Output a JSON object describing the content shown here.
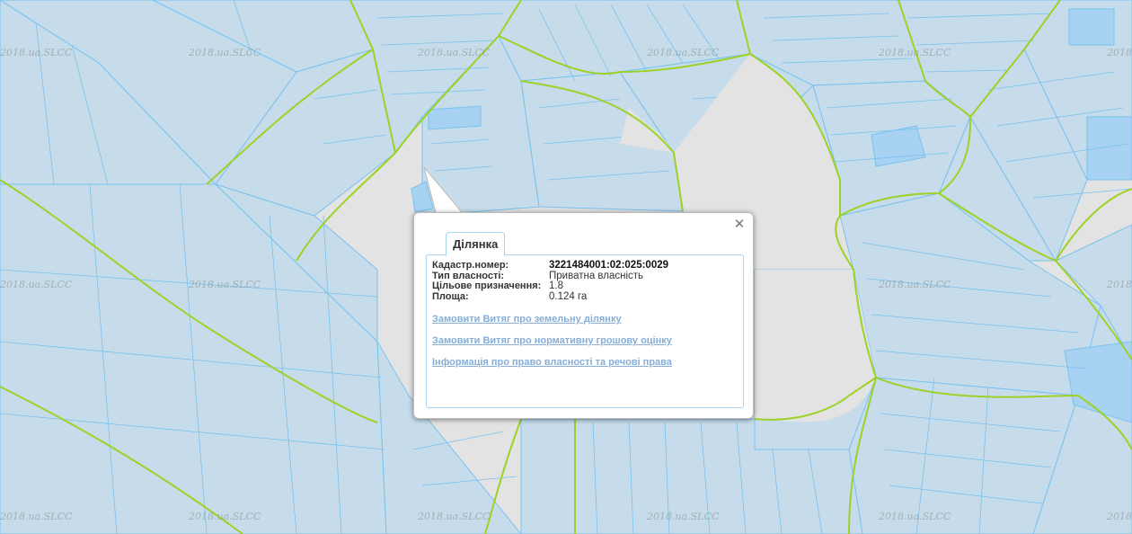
{
  "map": {
    "watermark": "2018.ua.SLCC",
    "colors": {
      "background": "#e3e3e3",
      "parcel_fill": "#c6dcea",
      "parcel_fill_selected": "#a8d2f2",
      "parcel_stroke": "#79c2ee",
      "boundary": "#9ed127"
    }
  },
  "popup": {
    "tab_label": "Ділянка",
    "close_icon": "close-icon",
    "fields": [
      {
        "label": "Кадастр.номер:",
        "value": "3221484001:02:025:0029"
      },
      {
        "label": "Тип власності:",
        "value": "Приватна власність"
      },
      {
        "label": "Цільове призначення:",
        "value": "1.8"
      },
      {
        "label": "Площа:",
        "value": "0.124 га"
      }
    ],
    "links": [
      "Замовити Витяг про земельну ділянку",
      "Замовити Витяг про нормативну грошову оцінку",
      "Інформація про право власності та речові права"
    ]
  }
}
